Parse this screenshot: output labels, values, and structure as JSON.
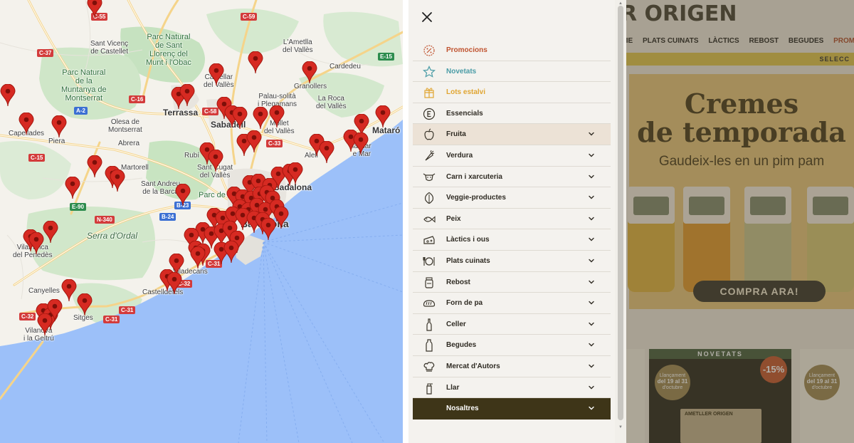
{
  "map": {
    "places": [
      {
        "name": "Sant Vicenç de Castellet",
        "lines": [
          "Sant Vicenç",
          "de Castellet"
        ]
      },
      {
        "name": "Parc Natural de Sant Llorenç del Munt i l'Obac",
        "lines": [
          "Parc Natural",
          "de Sant",
          "Llorenç del",
          "Munt i l'Obac"
        ]
      },
      {
        "name": "L'Ametlla del Vallès",
        "lines": [
          "L'Ametlla",
          "del Vallès"
        ]
      },
      {
        "name": "Cardedeu",
        "lines": [
          "Cardedeu"
        ]
      },
      {
        "name": "Parc Natural de la Muntanya de Montserrat",
        "lines": [
          "Parc Natural",
          "de la",
          "Muntanya de",
          "Montserrat"
        ]
      },
      {
        "name": "Castellar del Vallès",
        "lines": [
          "Castellar",
          "del Vallès"
        ]
      },
      {
        "name": "Granollers",
        "lines": [
          "Granollers"
        ]
      },
      {
        "name": "Palau-solità i Plegamans",
        "lines": [
          "Palau-solità",
          "i Plegamans"
        ]
      },
      {
        "name": "La Roca del Vallès",
        "lines": [
          "La Roca",
          "del Vallès"
        ]
      },
      {
        "name": "Capellades",
        "lines": [
          "Capellades"
        ]
      },
      {
        "name": "Olesa de Montserrat",
        "lines": [
          "Olesa de",
          "Montserrat"
        ]
      },
      {
        "name": "Terrassa",
        "lines": [
          "Terrassa"
        ]
      },
      {
        "name": "Sabadell",
        "lines": [
          "Sabadell"
        ]
      },
      {
        "name": "Mollet del Vallès",
        "lines": [
          "Mollet",
          "del Vallès"
        ]
      },
      {
        "name": "Mataró",
        "lines": [
          "Mataró"
        ]
      },
      {
        "name": "Piera",
        "lines": [
          "Piera"
        ]
      },
      {
        "name": "Abrera",
        "lines": [
          "Abrera"
        ]
      },
      {
        "name": "Rubí",
        "lines": [
          "Rubí"
        ]
      },
      {
        "name": "Alella",
        "lines": [
          "Alell"
        ]
      },
      {
        "name": "Vilassar de Mar",
        "lines": [
          "lassar",
          "e Mar"
        ]
      },
      {
        "name": "Martorell",
        "lines": [
          "Martorell"
        ]
      },
      {
        "name": "Sant Cugat del Vallès",
        "lines": [
          "Sant Cugat",
          "del Vallès"
        ]
      },
      {
        "name": "Sant Andreu de la Barca",
        "lines": [
          "Sant Andreu",
          "de la Barca"
        ]
      },
      {
        "name": "Parc de Collserola",
        "lines": [
          "Parc de Coll"
        ]
      },
      {
        "name": "Badalona",
        "lines": [
          "Badalona"
        ]
      },
      {
        "name": "Serra d'Ordal",
        "lines": [
          "Serra d'Ordal"
        ]
      },
      {
        "name": "Barcelona",
        "lines": [
          "Barcelona"
        ]
      },
      {
        "name": "Vilafranca del Penedès",
        "lines": [
          "Vilafranca",
          "del Penedès"
        ]
      },
      {
        "name": "Viladecans",
        "lines": [
          "Viladecans"
        ]
      },
      {
        "name": "Castelldefels",
        "lines": [
          "Castelldefels"
        ]
      },
      {
        "name": "Canyelles",
        "lines": [
          "Canyelles"
        ]
      },
      {
        "name": "Sitges",
        "lines": [
          "Sitges"
        ]
      },
      {
        "name": "Vilanova i la Geltrú",
        "lines": [
          "Vilanova",
          "i la Geltrú"
        ]
      }
    ],
    "roads": [
      "C-55",
      "C-59",
      "C-37",
      "E-15",
      "C-16",
      "A-2",
      "C-58",
      "C-33",
      "C-15",
      "E-90",
      "N-340",
      "B-24",
      "B-23",
      "C-31",
      "C-32",
      "C-32",
      "C-31"
    ],
    "marker_icon": "map-pin-icon"
  },
  "menu": {
    "close_icon": "close-icon",
    "items": [
      {
        "label": "Promocions",
        "icon": "badge-percent-icon",
        "style": "promo",
        "expandable": false
      },
      {
        "label": "Novetats",
        "icon": "star-icon",
        "style": "nov",
        "expandable": false
      },
      {
        "label": "Lots estalvi",
        "icon": "gift-box-icon",
        "style": "lots",
        "expandable": false
      },
      {
        "label": "Essencials",
        "icon": "letter-e-icon",
        "style": "normal",
        "expandable": false
      },
      {
        "label": "Fruita",
        "icon": "apple-icon",
        "style": "active",
        "expandable": true
      },
      {
        "label": "Verdura",
        "icon": "carrot-icon",
        "style": "normal",
        "expandable": true
      },
      {
        "label": "Carn i xarcuteria",
        "icon": "cow-icon",
        "style": "normal",
        "expandable": true
      },
      {
        "label": "Veggie-productes",
        "icon": "leaf-icon",
        "style": "normal",
        "expandable": true
      },
      {
        "label": "Peix",
        "icon": "fish-icon",
        "style": "normal",
        "expandable": true
      },
      {
        "label": "Làctics i ous",
        "icon": "cheese-icon",
        "style": "normal",
        "expandable": true
      },
      {
        "label": "Plats cuinats",
        "icon": "plate-cutlery-icon",
        "style": "normal",
        "expandable": true
      },
      {
        "label": "Rebost",
        "icon": "jar-icon",
        "style": "normal",
        "expandable": true
      },
      {
        "label": "Forn de pa",
        "icon": "bread-icon",
        "style": "normal",
        "expandable": true
      },
      {
        "label": "Celler",
        "icon": "wine-bottle-icon",
        "style": "normal",
        "expandable": true
      },
      {
        "label": "Begudes",
        "icon": "drink-bottle-icon",
        "style": "normal",
        "expandable": true
      },
      {
        "label": "Mercat d'Autors",
        "icon": "chef-hat-icon",
        "style": "normal",
        "expandable": true
      },
      {
        "label": "Llar",
        "icon": "spray-bottle-icon",
        "style": "normal",
        "expandable": true
      },
      {
        "label": "Nosaltres",
        "icon": "",
        "style": "dark",
        "expandable": true
      }
    ]
  },
  "store": {
    "brand": "R ORIGEN",
    "nav": [
      "GIE",
      "PLATS CUINATS",
      "LÀCTICS",
      "REBOST",
      "BEGUDES",
      "PROMOCIONS"
    ],
    "strip_text": "SELECC",
    "hero_title_1": "Cremes",
    "hero_title_2": "de temporada",
    "hero_subtitle": "Gaudeix-les en un pim pam",
    "cta": "COMPRA ARA!",
    "card_ribbon": "NOVETATS",
    "date_badge_1": [
      "Llançament",
      "del 19 al 31",
      "d'octubre"
    ],
    "date_badge_2": [
      "Llançament",
      "del 19 al 31",
      "d'octubre"
    ],
    "discount": "-15%",
    "product_brand": "AMETLLER ORIGEN"
  },
  "colors": {
    "sea": "#9cc0f9",
    "land": "#f4f2ec",
    "park": "#c7e3c2",
    "marker": "#d62a22",
    "promo": "#c0532f",
    "novetats": "#4a9ca6",
    "lots": "#e0a531",
    "menu_bg": "#f4f2ee",
    "active_bg": "#ece2d6",
    "dark_bg": "#3e3518"
  }
}
